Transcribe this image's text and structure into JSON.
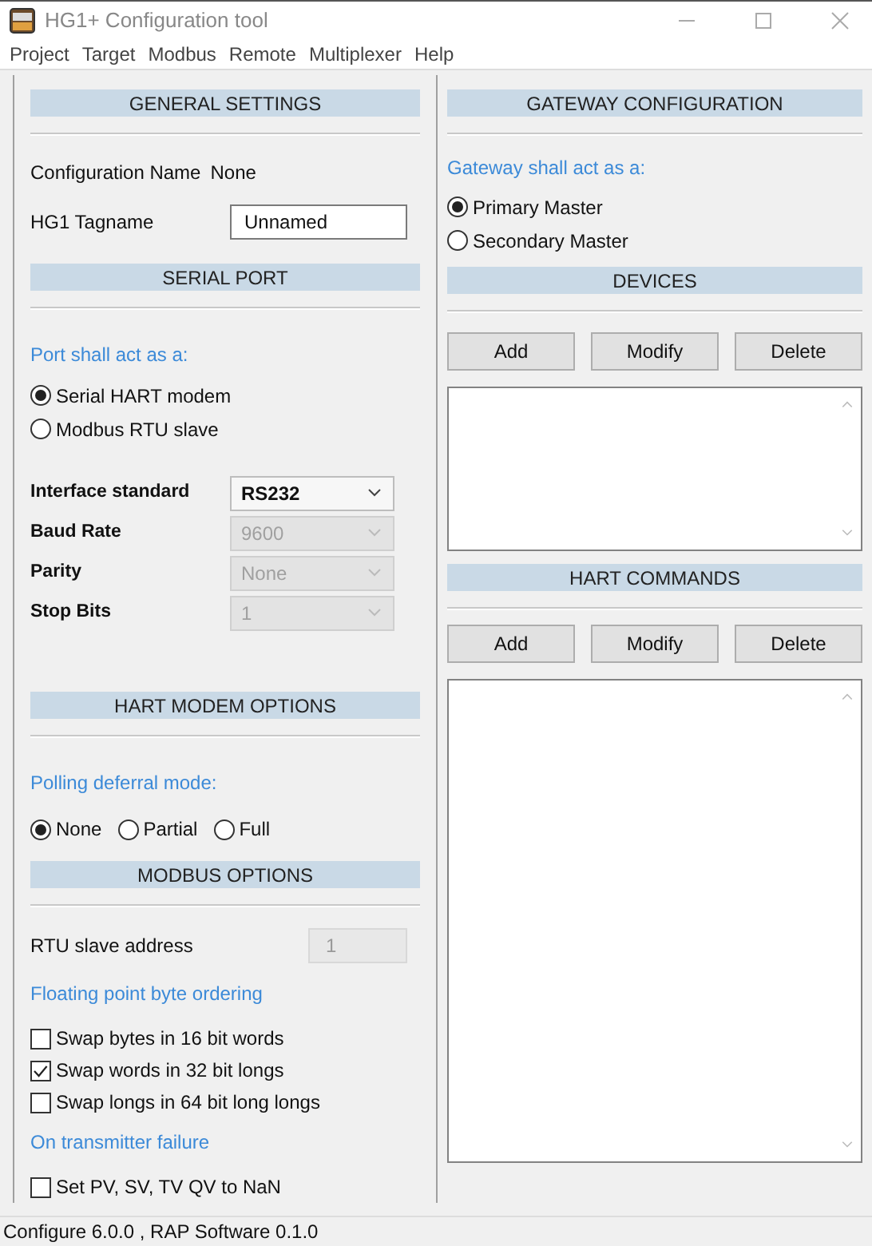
{
  "window": {
    "title": "HG1+ Configuration tool"
  },
  "menu": [
    "Project",
    "Target",
    "Modbus",
    "Remote",
    "Multiplexer",
    "Help"
  ],
  "left_sections": [
    {
      "title": "GENERAL SETTINGS",
      "items": [
        {
          "kind": "static",
          "label": "Configuration Name",
          "value": "None"
        },
        {
          "kind": "text",
          "label": "HG1 Tagname",
          "value": "Unnamed"
        }
      ]
    },
    {
      "title": "SERIAL PORT",
      "items": [
        {
          "kind": "caption",
          "text": "Port shall act as a:"
        },
        {
          "kind": "radio",
          "label": "Serial HART modem",
          "selected": true
        },
        {
          "kind": "radio",
          "label": "Modbus RTU slave",
          "selected": false
        },
        {
          "kind": "select",
          "label": "Interface standard",
          "value": "RS232",
          "disabled": false
        },
        {
          "kind": "select",
          "label": "Baud Rate",
          "value": "9600",
          "disabled": true
        },
        {
          "kind": "select",
          "label": "Parity",
          "value": "None",
          "disabled": true
        },
        {
          "kind": "select",
          "label": "Stop Bits",
          "value": "1",
          "disabled": true
        }
      ]
    },
    {
      "title": "HART MODEM OPTIONS",
      "items": [
        {
          "kind": "caption",
          "text": "Polling deferral mode:"
        },
        {
          "kind": "radio_row",
          "options": [
            {
              "label": "None",
              "selected": true
            },
            {
              "label": "Partial",
              "selected": false
            },
            {
              "label": "Full",
              "selected": false
            }
          ]
        }
      ]
    },
    {
      "title": "MODBUS OPTIONS",
      "items": [
        {
          "kind": "number",
          "label": "RTU slave address",
          "value": "1",
          "disabled": true
        },
        {
          "kind": "caption",
          "text": "Floating point byte ordering"
        },
        {
          "kind": "checkbox",
          "label": "Swap bytes in 16 bit words",
          "checked": false
        },
        {
          "kind": "checkbox",
          "label": "Swap words in 32 bit longs",
          "checked": true
        },
        {
          "kind": "checkbox",
          "label": "Swap longs in 64 bit long longs",
          "checked": false
        },
        {
          "kind": "caption",
          "text": "On transmitter failure"
        },
        {
          "kind": "checkbox",
          "label": "Set PV, SV, TV  QV to NaN",
          "checked": false
        }
      ]
    }
  ],
  "right_sections": [
    {
      "title": "GATEWAY CONFIGURATION",
      "items": [
        {
          "kind": "caption",
          "text": "Gateway shall act as a:"
        },
        {
          "kind": "radio",
          "label": "Primary Master",
          "selected": true
        },
        {
          "kind": "radio",
          "label": "Secondary Master",
          "selected": false
        }
      ]
    },
    {
      "title": "DEVICES",
      "items": [
        {
          "kind": "buttons",
          "labels": [
            "Add",
            "Modify",
            "Delete"
          ]
        },
        {
          "kind": "list_short"
        }
      ]
    },
    {
      "title": "HART COMMANDS",
      "items": [
        {
          "kind": "buttons",
          "labels": [
            "Add",
            "Modify",
            "Delete"
          ]
        },
        {
          "kind": "list_tall"
        }
      ]
    }
  ],
  "status_bar": "Configure 6.0.0 , RAP Software 0.1.0"
}
